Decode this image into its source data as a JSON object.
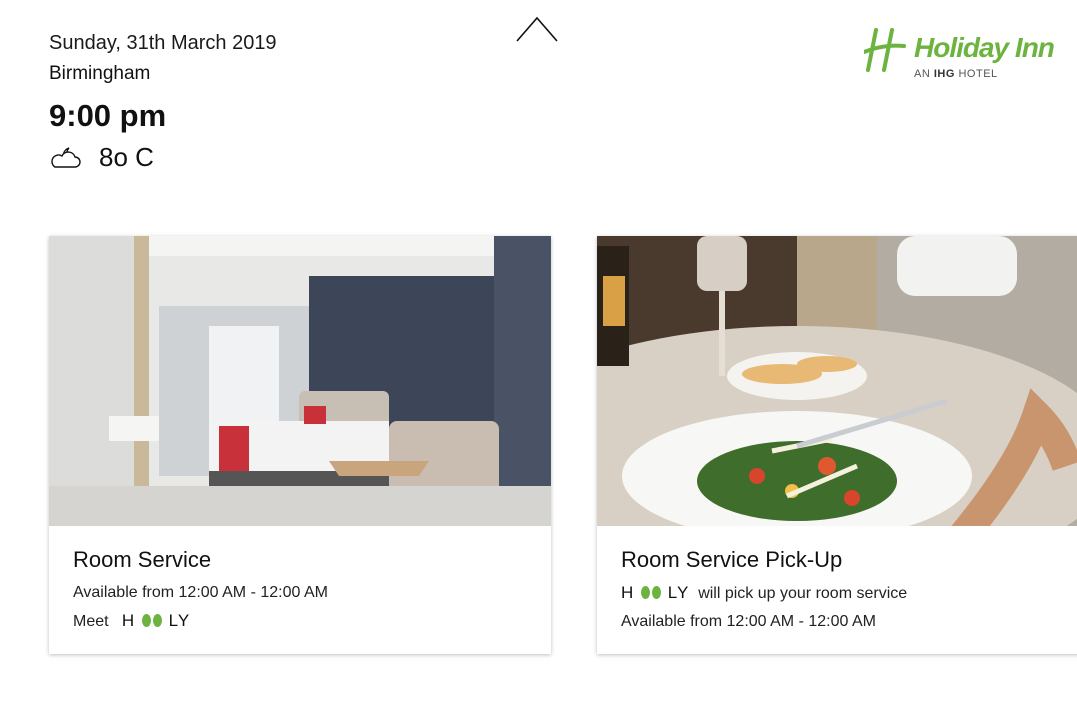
{
  "header": {
    "date": "Sunday, 31th March 2019",
    "city": "Birmingham",
    "time": "9:00 pm",
    "temperature": "8o C",
    "weather_icon": "partly-cloudy-night-icon"
  },
  "logo": {
    "name": "Holiday Inn",
    "tagline_prefix": "AN",
    "tagline_brand": "IHG",
    "tagline_suffix": "HOTEL"
  },
  "brand": {
    "name_left": "H",
    "name_right": "LY",
    "color": "#6cb33f"
  },
  "cards": [
    {
      "title": "Room Service",
      "line1": "Available from 12:00 AM - 12:00 AM",
      "meet_label": "Meet",
      "image": "hotel-room-photo"
    },
    {
      "title": "Room Service Pick-Up",
      "pickup_text": "will pick up your room service",
      "line2": "Available from 12:00 AM - 12:00 AM",
      "image": "salad-dish-photo"
    }
  ]
}
